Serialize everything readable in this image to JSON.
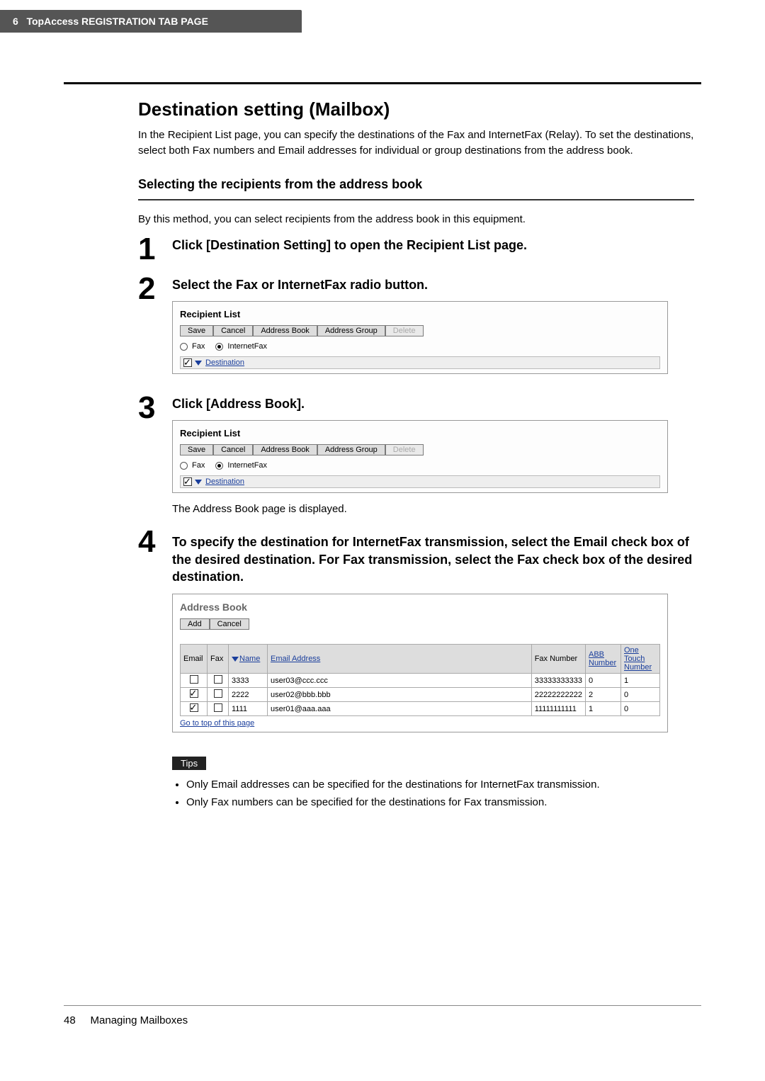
{
  "header": {
    "chapter_num": "6",
    "chapter_title": "TopAccess REGISTRATION TAB PAGE"
  },
  "sectionTitle": "Destination setting (Mailbox)",
  "intro": "In the Recipient List page, you can specify the destinations of the Fax and InternetFax (Relay). To set the destinations, select both Fax numbers and Email addresses for individual or group destinations from the address book.",
  "subHeading": "Selecting the recipients from the address book",
  "subIntro": "By this method, you can select recipients from the address book in this equipment.",
  "steps": {
    "s1": {
      "num": "1",
      "title": "Click [Destination Setting] to open the Recipient List page."
    },
    "s2": {
      "num": "2",
      "title": "Select the Fax or InternetFax radio button."
    },
    "s3": {
      "num": "3",
      "title": "Click [Address Book].",
      "note": "The Address Book page is displayed."
    },
    "s4": {
      "num": "4",
      "title": "To specify the destination for InternetFax transmission, select the Email check box of the desired destination. For Fax transmission, select the Fax check box of the desired destination."
    }
  },
  "recipientUI": {
    "title": "Recipient List",
    "buttons": {
      "save": "Save",
      "cancel": "Cancel",
      "addressBook": "Address Book",
      "addressGroup": "Address Group",
      "delete": "Delete"
    },
    "radios": {
      "fax": "Fax",
      "ifax": "InternetFax"
    },
    "destinationLink": "Destination"
  },
  "addressBookUI": {
    "title": "Address Book",
    "buttons": {
      "add": "Add",
      "cancel": "Cancel"
    },
    "headers": {
      "email": "Email",
      "fax": "Fax",
      "name": "Name",
      "emailAddr": "Email Address",
      "faxNum": "Fax Number",
      "abb": "ABB Number",
      "oneTouch": "One Touch Number"
    },
    "rows": [
      {
        "emailChecked": false,
        "faxChecked": false,
        "name": "3333",
        "email": "user03@ccc.ccc",
        "fax": "33333333333",
        "abb": "0",
        "ot": "1"
      },
      {
        "emailChecked": true,
        "faxChecked": false,
        "name": "2222",
        "email": "user02@bbb.bbb",
        "fax": "22222222222",
        "abb": "2",
        "ot": "0"
      },
      {
        "emailChecked": true,
        "faxChecked": false,
        "name": "1111",
        "email": "user01@aaa.aaa",
        "fax": "11111111111",
        "abb": "1",
        "ot": "0"
      }
    ],
    "gotoTop": "Go to top of this page"
  },
  "tips": {
    "label": "Tips",
    "items": [
      "Only Email addresses can be specified for the destinations for InternetFax transmission.",
      "Only Fax numbers can be specified for the destinations for Fax transmission."
    ]
  },
  "footer": {
    "pageNum": "48",
    "pageLabel": "Managing Mailboxes"
  }
}
